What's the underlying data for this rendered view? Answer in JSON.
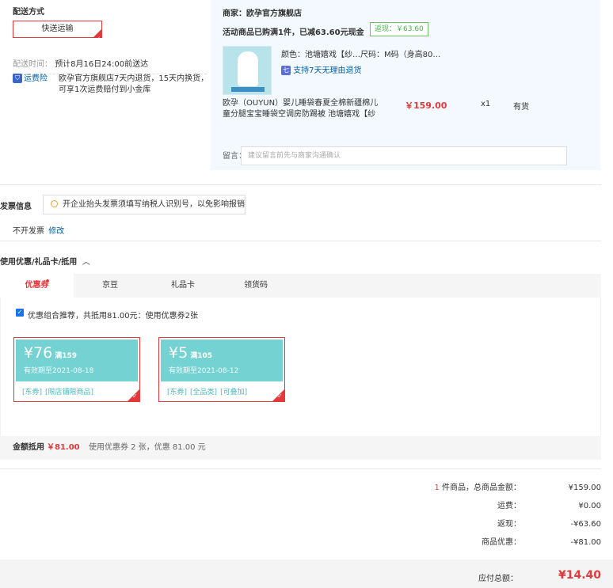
{
  "delivery": {
    "title": "配送方式",
    "method": "快送运输",
    "time_label": "配送时间：",
    "time_value": "预计8月16日24:00前送达",
    "insurance_icon": "shield-icon",
    "insurance_label": "运费险",
    "insurance_line1": "欧孕官方旗舰店7天内退货，15天内换货，",
    "insurance_line2": "可享1次运费赔付到小金库"
  },
  "store": {
    "seller": "商家：欧孕官方旗舰店",
    "promo": "活动商品已购满1件，已减63.60元现金",
    "cashback_tag": "返现：￥63.60",
    "spec": "颜色：池塘嬉戏【纱…尺码：M码（身高80…",
    "return_policy": "支持7天无理由退货",
    "product_line1": "欧孕（OUYUN）婴儿睡袋春夏全棉新疆棉儿",
    "product_line2": "童分腿宝宝睡袋空调房防踢被 池塘嬉戏【纱",
    "price": "￥159.00",
    "qty": "x1",
    "stock": "有货",
    "remark_label": "留言：",
    "remark_placeholder": "建议留言前先与商家沟通确认"
  },
  "invoice": {
    "title": "发票信息",
    "tip": "开企业抬头发票须填写纳税人识别号，以免影响报销",
    "status": "不开发票",
    "edit": "修改"
  },
  "coupons": {
    "title": "使用优惠/礼品卡/抵用",
    "tabs": [
      "优惠券",
      "京豆",
      "礼品卡",
      "领货码"
    ],
    "combo_text": "优惠组合推荐，共抵用81.00元：使用优惠券2张",
    "list": [
      {
        "amount": "¥76",
        "cond": "满159",
        "expire": "有效期至2021-08-18",
        "tags": [
          "[东券]",
          "[限店铺限商品]"
        ]
      },
      {
        "amount": "¥5",
        "cond": "满105",
        "expire": "有效期至2021-08-12",
        "tags": [
          "[东券]",
          "[全品类]",
          "[可叠加]"
        ]
      }
    ],
    "deduct_label": "金额抵用",
    "deduct_value": "￥81.00",
    "deduct_detail": "使用优惠券 2 张，优惠 81.00 元"
  },
  "summary": {
    "count": "1",
    "items_label": "件商品，总商品金额：",
    "items_value": "¥159.00",
    "freight_label": "运费：",
    "freight_value": "¥0.00",
    "cashback_label": "返现：",
    "cashback_value": "-¥63.60",
    "discount_label": "商品优惠：",
    "discount_value": "-¥81.00",
    "total_label": "应付总额：",
    "total_value": "¥14.40"
  },
  "colors": {
    "accent": "#e4393c",
    "coupon_teal": "#74d2d2",
    "link": "#005ea7"
  }
}
